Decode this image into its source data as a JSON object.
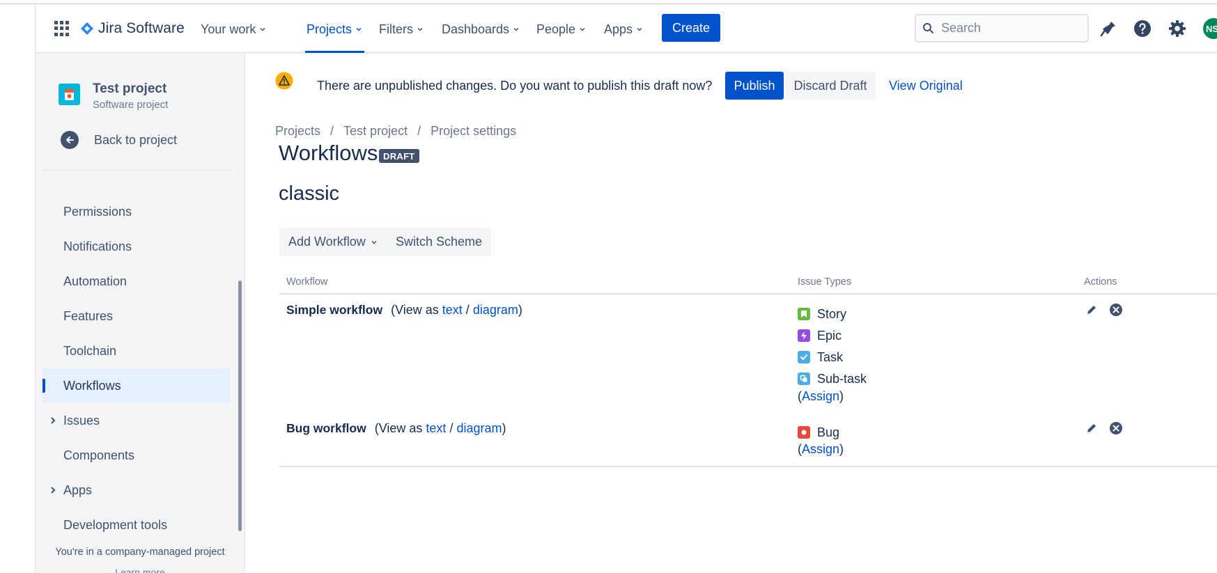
{
  "topnav": {
    "product": "Jira Software",
    "items": [
      {
        "label": "Your work"
      },
      {
        "label": "Projects"
      },
      {
        "label": "Filters"
      },
      {
        "label": "Dashboards"
      },
      {
        "label": "People"
      },
      {
        "label": "Apps"
      }
    ],
    "active_item": "Projects",
    "create_label": "Create",
    "search_placeholder": "Search",
    "avatar_initials": "NS",
    "accent_color": "#0052cc"
  },
  "sidebar": {
    "project_name": "Test project",
    "project_type": "Software project",
    "back_label": "Back to project",
    "items": [
      {
        "label": "Permissions"
      },
      {
        "label": "Notifications"
      },
      {
        "label": "Automation"
      },
      {
        "label": "Features"
      },
      {
        "label": "Toolchain"
      },
      {
        "label": "Workflows"
      },
      {
        "label": "Issues"
      },
      {
        "label": "Components"
      },
      {
        "label": "Apps"
      },
      {
        "label": "Development tools"
      }
    ],
    "selected_item": "Workflows",
    "footer": "You're in a company-managed project",
    "footer_partial": "Learn more"
  },
  "banner": {
    "message": "There are unpublished changes. Do you want to publish this draft now?",
    "publish_label": "Publish",
    "discard_label": "Discard Draft",
    "view_original_label": "View Original"
  },
  "breadcrumb": [
    "Projects",
    "Test project",
    "Project settings"
  ],
  "page": {
    "title": "Workflows",
    "badge": "DRAFT",
    "scheme_name": "classic",
    "add_workflow_label": "Add Workflow",
    "switch_scheme_label": "Switch Scheme"
  },
  "table": {
    "headers": {
      "workflow": "Workflow",
      "issue_types": "Issue Types",
      "actions": "Actions"
    },
    "view_as_prefix": "(View as ",
    "text_link": "text",
    "slash": " / ",
    "diagram_link": "diagram",
    "view_as_suffix": ")",
    "assign_link": "Assign",
    "rows": [
      {
        "name": "Simple workflow",
        "issue_types": [
          {
            "label": "Story",
            "icon": "story-icon",
            "color": "#63ba3c"
          },
          {
            "label": "Epic",
            "icon": "epic-icon",
            "color": "#904ee2"
          },
          {
            "label": "Task",
            "icon": "task-icon",
            "color": "#4bade8"
          },
          {
            "label": "Sub-task",
            "icon": "subtask-icon",
            "color": "#4bade8"
          }
        ]
      },
      {
        "name": "Bug workflow",
        "issue_types": [
          {
            "label": "Bug",
            "icon": "bug-icon",
            "color": "#e5493a"
          }
        ]
      }
    ]
  }
}
